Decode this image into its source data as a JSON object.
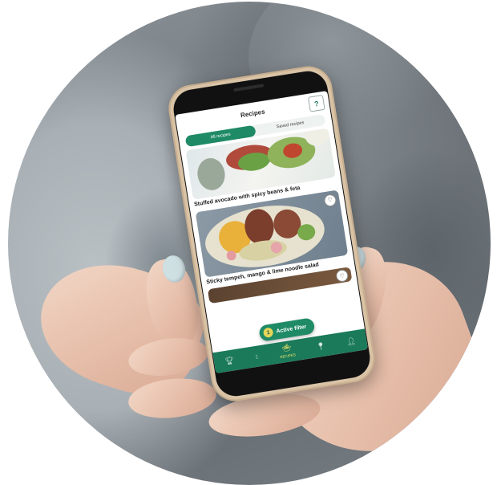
{
  "app": {
    "title": "Recipes",
    "help_glyph": "?"
  },
  "tabs": [
    {
      "label": "All recipes",
      "active": true
    },
    {
      "label": "Saved recipes",
      "active": false
    }
  ],
  "recipes": [
    {
      "title": "Stuffed avocado with spicy beans & feta",
      "icon": "save-heart-icon"
    },
    {
      "title": "Sticky tempeh, mango & lime noodle salad",
      "icon": "save-heart-icon"
    }
  ],
  "filter": {
    "count": "1",
    "label": "Active filter"
  },
  "bottom_nav": [
    {
      "icon": "trophy-icon",
      "label": "",
      "active": false
    },
    {
      "icon": "drops-icon",
      "label": "",
      "active": false
    },
    {
      "icon": "recipes-icon",
      "label": "RECIPES",
      "active": true
    },
    {
      "icon": "location-pin-icon",
      "label": "",
      "active": false
    },
    {
      "icon": "profile-icon",
      "label": "",
      "active": false
    }
  ],
  "colors": {
    "brand_green": "#1f8a66",
    "nav_green": "#1a7a5a",
    "accent_yellow": "#e4d65a"
  }
}
